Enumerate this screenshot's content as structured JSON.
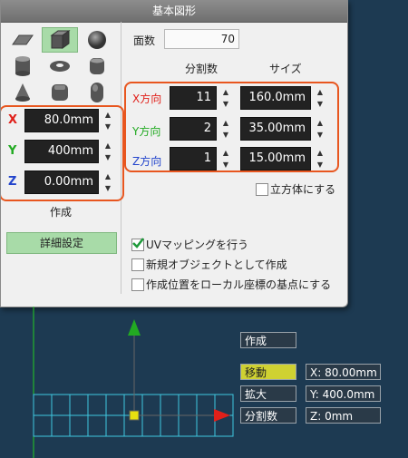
{
  "title": "基本図形",
  "shapes": {
    "items": [
      "plane-icon",
      "cube-icon",
      "sphere-icon",
      "cylinder-icon",
      "torus-icon",
      "rounded-cylinder-icon",
      "cone-icon",
      "rounded-cube-icon",
      "capsule-icon"
    ],
    "selected_index": 1
  },
  "faces": {
    "label": "面数",
    "value": "70"
  },
  "headers": {
    "divisions": "分割数",
    "size": "サイズ"
  },
  "position": {
    "x": {
      "axis": "X",
      "value": "80.0mm"
    },
    "y": {
      "axis": "Y",
      "value": "400mm"
    },
    "z": {
      "axis": "Z",
      "value": "0.00mm"
    }
  },
  "directions": [
    {
      "label": "X方向",
      "divisions": "11",
      "size": "160.0mm"
    },
    {
      "label": "Y方向",
      "divisions": "2",
      "size": "35.00mm"
    },
    {
      "label": "Z方向",
      "divisions": "1",
      "size": "15.00mm"
    }
  ],
  "cube_checkbox": {
    "label": "立方体にする",
    "checked": false
  },
  "create_button": "作成",
  "detail_button": "詳細設定",
  "options": [
    {
      "label": "UVマッピングを行う",
      "checked": true
    },
    {
      "label": "新規オブジェクトとして作成",
      "checked": false
    },
    {
      "label": "作成位置をローカル座標の基点にする",
      "checked": false
    }
  ],
  "viewport": {
    "create": "作成",
    "move": "移動",
    "scale": "拡大",
    "divide": "分割数",
    "coord_x": "X: 80.00mm",
    "coord_y": "Y: 400.0mm",
    "coord_z": "Z: 0mm"
  },
  "colors": {
    "x_axis": "#e0201a",
    "y_axis": "#22aa22",
    "z_axis": "#2244cc",
    "highlight": "#e8561f",
    "selected": "#a8dba8",
    "viewport_bg": "#1d3a52",
    "grid": "#40c8e0"
  }
}
